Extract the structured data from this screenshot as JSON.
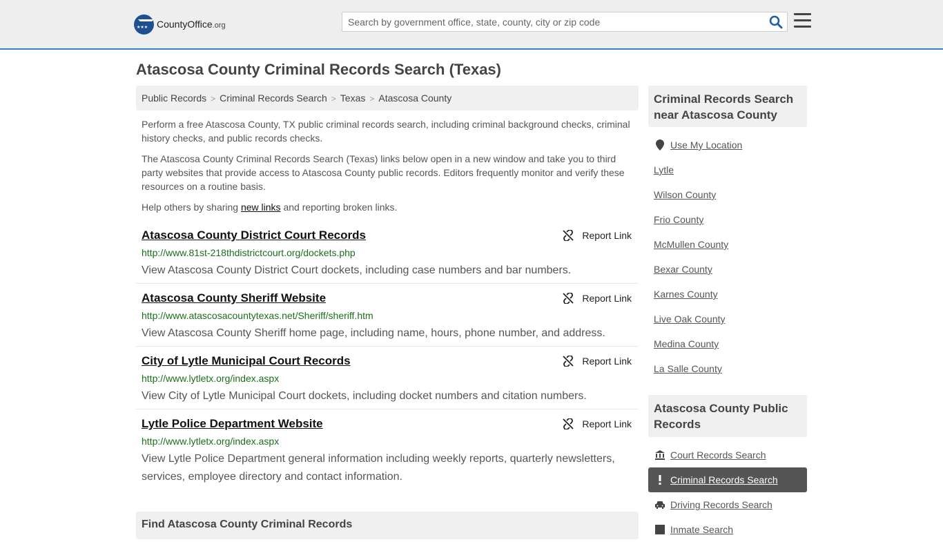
{
  "header": {
    "logo_text": "CountyOffice",
    "logo_suffix": ".org",
    "search_placeholder": "Search by government office, state, county, city or zip code"
  },
  "page_title": "Atascosa County Criminal Records Search (Texas)",
  "breadcrumb": [
    "Public Records",
    "Criminal Records Search",
    "Texas",
    "Atascosa County"
  ],
  "intro": {
    "p1": "Perform a free Atascosa County, TX public criminal records search, including criminal background checks, criminal history checks, and public records checks.",
    "p2": "The Atascosa County Criminal Records Search (Texas) links below open in a new window and take you to third party websites that provide access to Atascosa County public records. Editors frequently monitor and verify these resources on a routine basis.",
    "p3_before": "Help others by sharing ",
    "p3_link": "new links",
    "p3_after": " and reporting broken links."
  },
  "report_label": "Report Link",
  "records": [
    {
      "title": "Atascosa County District Court Records",
      "url": "http://www.81st-218thdistrictcourt.org/dockets.php",
      "desc": "View Atascosa County District Court dockets, including case numbers and bar numbers."
    },
    {
      "title": "Atascosa County Sheriff Website",
      "url": "http://www.atascosacountytexas.net/Sheriff/sheriff.htm",
      "desc": "View Atascosa County Sheriff home page, including name, hours, phone number, and address."
    },
    {
      "title": "City of Lytle Municipal Court Records",
      "url": "http://www.lytletx.org/index.aspx",
      "desc": "View City of Lytle Municipal Court dockets, including docket numbers and citation numbers."
    },
    {
      "title": "Lytle Police Department Website",
      "url": "http://www.lytletx.org/index.aspx",
      "desc": "View Lytle Police Department general information including weekly reports, quarterly newsletters, services, employee directory and contact information."
    }
  ],
  "find_heading": "Find Atascosa County Criminal Records",
  "sidebar": {
    "nearby_heading": "Criminal Records Search near Atascosa County",
    "use_location": "Use My Location",
    "nearby": [
      "Lytle",
      "Wilson County",
      "Frio County",
      "McMullen County",
      "Bexar County",
      "Karnes County",
      "Live Oak County",
      "Medina County",
      "La Salle County"
    ],
    "public_heading": "Atascosa County Public Records",
    "public_links": [
      {
        "label": "Court Records Search",
        "icon": "courthouse-icon"
      },
      {
        "label": "Criminal Records Search",
        "icon": "exclamation-icon"
      },
      {
        "label": "Driving Records Search",
        "icon": "car-icon"
      },
      {
        "label": "Inmate Search",
        "icon": "inmate-icon"
      }
    ]
  },
  "colors": {
    "accent_border": "#3a7cc4",
    "url_green": "#1b6e1b",
    "active_bg": "#555555"
  }
}
